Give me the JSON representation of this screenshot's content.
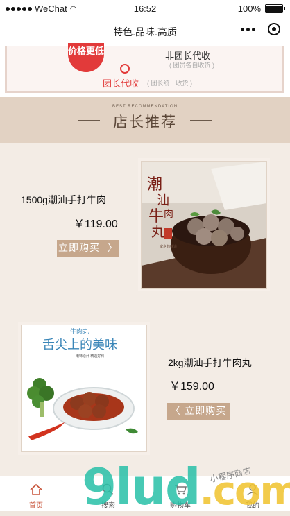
{
  "status_bar": {
    "carrier": "WeChat",
    "time": "16:52",
    "battery": "100%"
  },
  "navbar": {
    "title": "特色.品味.高质"
  },
  "banner": {
    "badge": "价格更低",
    "option1": "非团长代收",
    "option1_sub": "( 团员各自收货 )",
    "option2": "团长代收",
    "option2_sub": "( 团长统一收货 )"
  },
  "section": {
    "en": "BEST RECOMMENDATION",
    "zh": "店长推荐"
  },
  "products": [
    {
      "name": "1500g潮汕手打牛肉",
      "price": "￥119.00",
      "buy": "立即购买",
      "buy_icon": "chevron-right-icon",
      "image_text": [
        "潮",
        "汕",
        "牛",
        "肉",
        "丸"
      ],
      "image_tag": "家乡的味道"
    },
    {
      "name": "2kg潮汕手打牛肉丸",
      "price": "￥159.00",
      "buy": "立即购买",
      "buy_icon": "chevron-left-icon",
      "image_title": "牛肉丸",
      "image_headline": "舌尖上的美味",
      "image_sub": "潮味原汁 精选好料"
    }
  ],
  "tabs": [
    {
      "label": "首页",
      "icon": "home-icon",
      "active": true
    },
    {
      "label": "搜索",
      "icon": "search-icon",
      "active": false
    },
    {
      "label": "购物车",
      "icon": "cart-icon",
      "active": false
    },
    {
      "label": "我的",
      "icon": "user-icon",
      "active": false
    }
  ],
  "watermark": {
    "brand": "9lud",
    "suffix": ".com",
    "sub": "小程序商店"
  },
  "colors": {
    "accent": "#c6a78c",
    "active_tab": "#c8553b",
    "banner_red": "#e23a3a"
  }
}
